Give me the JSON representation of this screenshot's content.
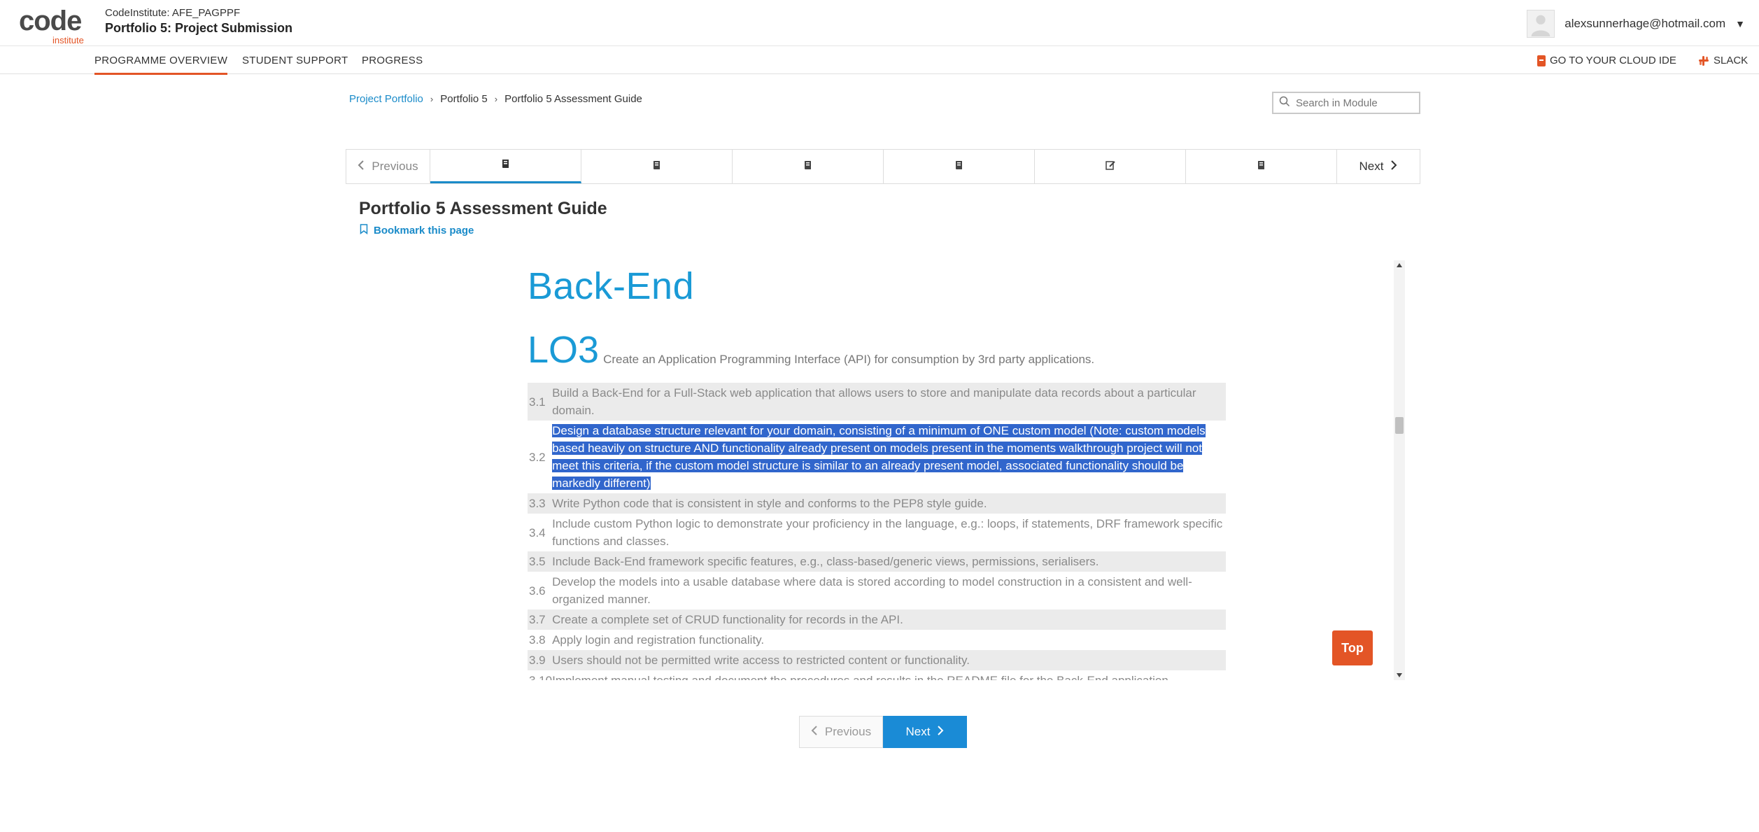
{
  "header": {
    "logo_word": "code",
    "logo_sub": "institute",
    "course_org": "CodeInstitute: AFE_PAGPPF",
    "course_title": "Portfolio 5: Project Submission",
    "user_email": "alexsunnerhage@hotmail.com"
  },
  "nav": {
    "items": [
      "PROGRAMME OVERVIEW",
      "STUDENT SUPPORT",
      "PROGRESS"
    ],
    "active": "PROGRAMME OVERVIEW",
    "cloud_ide": "GO TO YOUR CLOUD IDE",
    "slack": "SLACK"
  },
  "breadcrumb": {
    "items": [
      "Project Portfolio",
      "Portfolio 5",
      "Portfolio 5 Assessment Guide"
    ]
  },
  "search": {
    "placeholder": "Search in Module"
  },
  "sequence": {
    "previous": "Previous",
    "next": "Next",
    "tabs": [
      "book-icon",
      "book-icon",
      "book-icon",
      "book-icon",
      "edit-icon",
      "book-icon"
    ],
    "active_tab": 0
  },
  "unit": {
    "title": "Portfolio 5 Assessment Guide",
    "bookmark": "Bookmark this page"
  },
  "content": {
    "heading": "Back-End",
    "lo_number": "LO3",
    "lo_text": "Create an Application Programming Interface (API) for consumption by 3rd party applications.",
    "criteria": [
      {
        "num": "3.1",
        "text": "Build a Back-End for a Full-Stack web application that allows users to store and manipulate data records about a particular domain."
      },
      {
        "num": "3.2",
        "text": "Design a database structure relevant for your domain, consisting of a minimum of ONE custom model (Note: custom models based heavily on structure AND functionality already present on models present in the moments walkthrough project will not meet this criteria, if the custom model structure is similar to an already present model, associated functionality should be markedly different)"
      },
      {
        "num": "3.3",
        "text": "Write Python code that is consistent in style and conforms to the PEP8 style guide."
      },
      {
        "num": "3.4",
        "text": "Include custom Python logic to demonstrate your proficiency in the language, e.g.: loops, if statements, DRF framework specific functions and classes."
      },
      {
        "num": "3.5",
        "text": "Include Back-End framework specific features, e.g., class-based/generic views, permissions, serialisers."
      },
      {
        "num": "3.6",
        "text": "Develop the models into a usable database where data is stored according to model construction in a consistent and well-organized manner."
      },
      {
        "num": "3.7",
        "text": "Create a complete set of CRUD functionality for records in the API."
      },
      {
        "num": "3.8",
        "text": "Apply login and registration functionality."
      },
      {
        "num": "3.9",
        "text": "Users should not be permitted write access to restricted content or functionality."
      },
      {
        "num": "3.10",
        "text": "Implement manual testing and document the procedures and results in the README file for the Back-End application."
      }
    ],
    "top_button": "Top"
  },
  "bottom_nav": {
    "previous": "Previous",
    "next": "Next"
  },
  "colors": {
    "accent": "#e35526",
    "link": "#1a8bc9",
    "heading": "#1a9ad6",
    "selection": "#3166cc"
  }
}
